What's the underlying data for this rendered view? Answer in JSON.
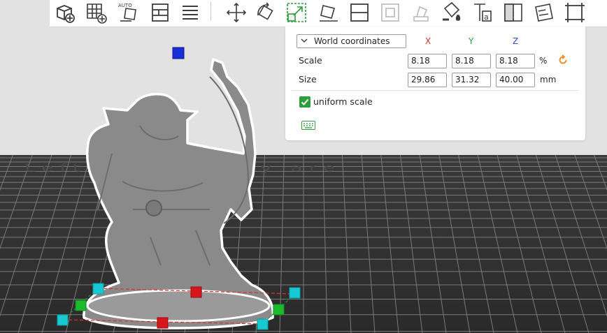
{
  "bed": {
    "watermark_text": "Left nozzle only are"
  },
  "scale_panel": {
    "coordinate_system": "World coordinates",
    "axes": {
      "x": "X",
      "y": "Y",
      "z": "Z"
    },
    "axis_colors": {
      "x": "#d9362b",
      "y": "#2e9d3c",
      "z": "#2f4fc5"
    },
    "scale": {
      "label": "Scale",
      "x": "8.18",
      "y": "8.18",
      "z": "8.18",
      "unit": "%"
    },
    "size": {
      "label": "Size",
      "x": "29.86",
      "y": "31.32",
      "z": "40.00",
      "unit": "mm"
    },
    "uniform_scale": {
      "label": "uniform scale",
      "checked": true
    }
  },
  "toolbar": {
    "icons": [
      "add-object-icon",
      "arrange-grid-icon",
      "auto-orient-icon",
      "layout-icon",
      "layers-list-icon",
      "move-icon",
      "rotate-icon",
      "scale-icon",
      "lay-on-face-icon",
      "split-objects-icon",
      "cut-icon",
      "support-paint-icon",
      "color-paint-icon",
      "text-icon",
      "seam-paint-icon",
      "measure-icon",
      "assembly-icon"
    ]
  },
  "colors": {
    "accent": "#2e9d3c",
    "handle_cyan": "#17c9d2",
    "handle_green": "#1dbb2b",
    "handle_red": "#d8141c",
    "handle_blue": "#1a2ed6",
    "reset_orange": "#f08a1c"
  }
}
